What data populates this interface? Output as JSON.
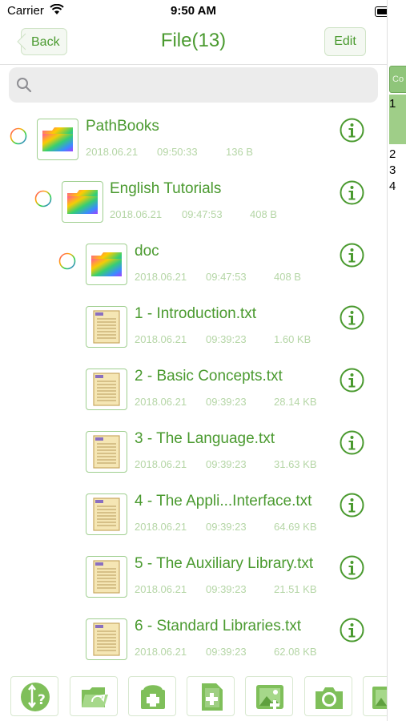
{
  "status_bar": {
    "carrier": "Carrier",
    "time": "9:50 AM"
  },
  "nav": {
    "back_label": "Back",
    "title": "File(13)",
    "edit_label": "Edit"
  },
  "search": {
    "placeholder": ""
  },
  "files": [
    {
      "name": "PathBooks",
      "date": "2018.06.21",
      "time": "09:50:33",
      "size": "136 B",
      "type": "folder",
      "expanded": true
    },
    {
      "name": "English Tutorials",
      "date": "2018.06.21",
      "time": "09:47:53",
      "size": "408 B",
      "type": "folder",
      "expanded": true
    },
    {
      "name": "doc",
      "date": "2018.06.21",
      "time": "09:47:53",
      "size": "408 B",
      "type": "folder",
      "expanded": false
    },
    {
      "name": "1 - Introduction.txt",
      "date": "2018.06.21",
      "time": "09:39:23",
      "size": "1.60 KB",
      "type": "txt"
    },
    {
      "name": "2 - Basic Concepts.txt",
      "date": "2018.06.21",
      "time": "09:39:23",
      "size": "28.14 KB",
      "type": "txt"
    },
    {
      "name": "3 - The Language.txt",
      "date": "2018.06.21",
      "time": "09:39:23",
      "size": "31.63 KB",
      "type": "txt"
    },
    {
      "name": "4 - The Appli...Interface.txt",
      "date": "2018.06.21",
      "time": "09:39:23",
      "size": "64.69 KB",
      "type": "txt"
    },
    {
      "name": "5 - The Auxiliary Library.txt",
      "date": "2018.06.21",
      "time": "09:39:23",
      "size": "21.51 KB",
      "type": "txt"
    },
    {
      "name": "6 - Standard Libraries.txt",
      "date": "2018.06.21",
      "time": "09:39:23",
      "size": "62.08 KB",
      "type": "txt"
    }
  ],
  "side_panel": {
    "tab_label": "Co",
    "numbers": [
      "1",
      "2",
      "3",
      "4"
    ]
  },
  "toolbar": {
    "icons": [
      "sort-help-icon",
      "open-folder-icon",
      "new-folder-icon",
      "new-file-icon",
      "add-photo-icon",
      "camera-icon",
      "image-icon"
    ]
  },
  "colors": {
    "accent": "#4a9a2f",
    "meta": "#b5d6a6",
    "border": "#9fcf8f"
  }
}
